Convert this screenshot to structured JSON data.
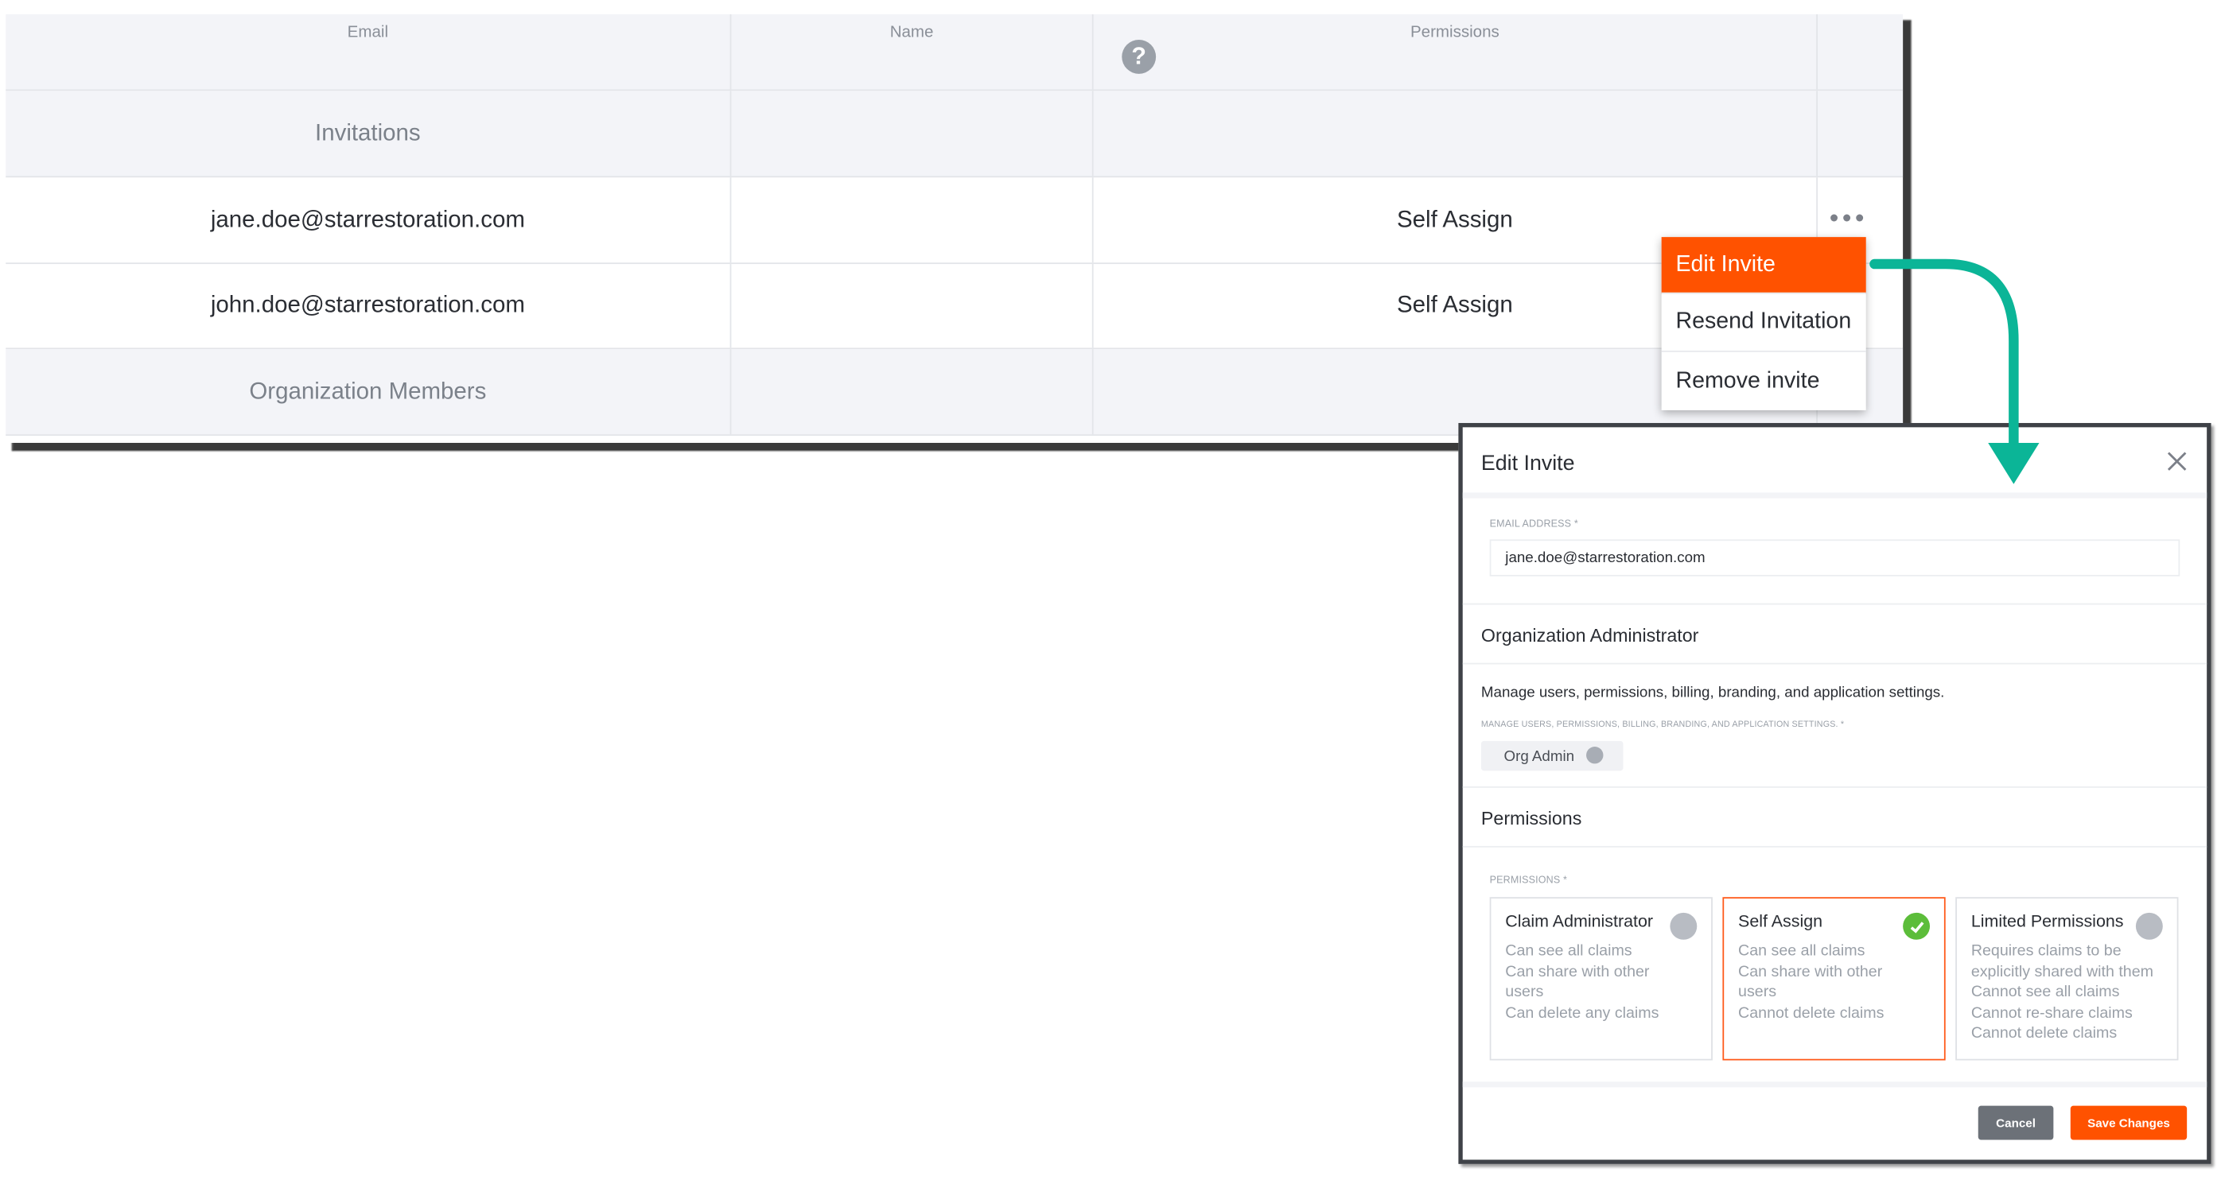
{
  "table": {
    "headers": {
      "email": "Email",
      "name": "Name",
      "permissions": "Permissions"
    },
    "help_icon": "question-circle-icon",
    "sections": {
      "invitations": "Invitations",
      "org_members": "Organization Members"
    },
    "rows": [
      {
        "email": "jane.doe@starrestoration.com",
        "name": "",
        "permission": "Self Assign"
      },
      {
        "email": "john.doe@starrestoration.com",
        "name": "",
        "permission": "Self Assign"
      }
    ]
  },
  "menu": {
    "items": [
      "Edit Invite",
      "Resend Invitation",
      "Remove invite"
    ],
    "active_color": "#ff5200"
  },
  "arrow_color": "#0bb597",
  "modal": {
    "title": "Edit Invite",
    "email_label": "EMAIL ADDRESS *",
    "email_value": "jane.doe@starrestoration.com",
    "org_admin_section": "Organization Administrator",
    "org_admin_desc": "Manage users, permissions, billing, branding, and application settings.",
    "org_admin_field_label": "MANAGE USERS, PERMISSIONS, BILLING, BRANDING, AND APPLICATION SETTINGS. *",
    "org_admin_toggle_label": "Org Admin",
    "org_admin_toggle_on": false,
    "permissions_section": "Permissions",
    "permissions_field_label": "PERMISSIONS *",
    "cards": [
      {
        "title": "Claim Administrator",
        "lines": [
          "Can see all claims",
          "Can share with other",
          "users",
          "Can delete any claims"
        ],
        "selected": false
      },
      {
        "title": "Self Assign",
        "lines": [
          "Can see all claims",
          "Can share with other",
          "users",
          "Cannot delete claims"
        ],
        "selected": true
      },
      {
        "title": "Limited Permissions",
        "lines": [
          "Requires claims to be",
          "explicitly shared with them",
          "Cannot see all claims",
          "Cannot re-share claims",
          "Cannot delete claims"
        ],
        "selected": false
      }
    ],
    "cancel_label": "Cancel",
    "save_label": "Save Changes",
    "accent_color": "#ff5200",
    "check_color": "#5cbd3a"
  }
}
